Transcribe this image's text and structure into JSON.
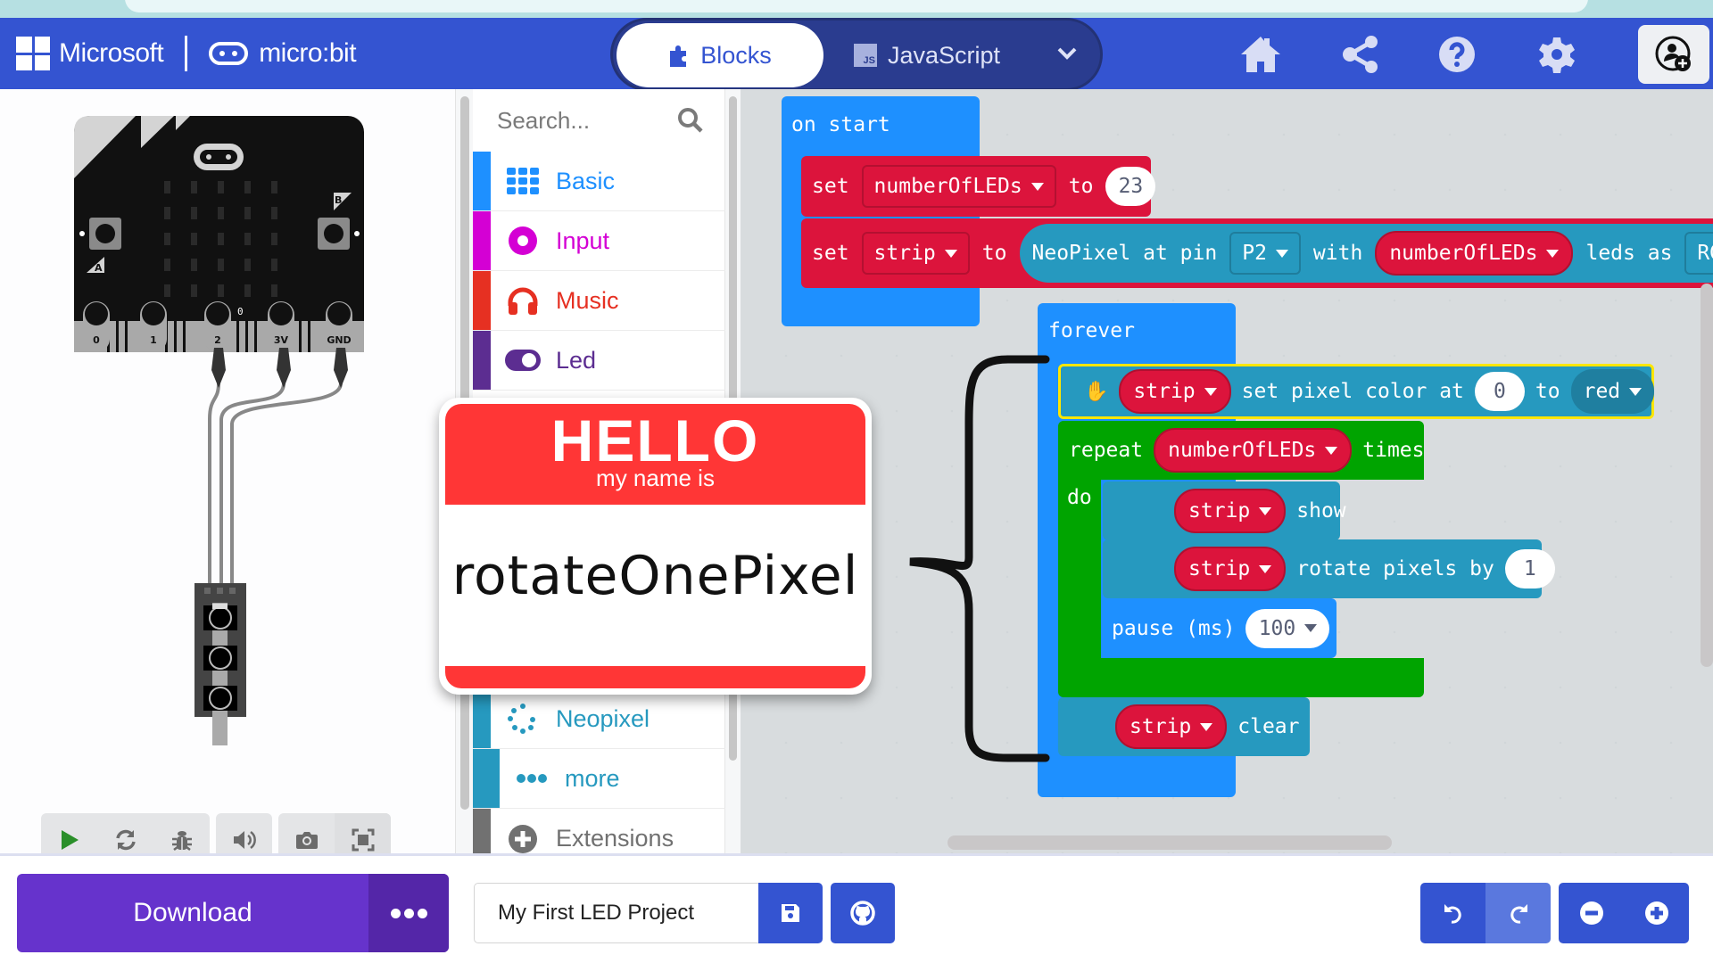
{
  "header": {
    "brand_microsoft": "Microsoft",
    "brand_microbit": "micro:bit",
    "tabs": [
      {
        "label": "Blocks",
        "icon": "puzzle-icon",
        "active": true
      },
      {
        "label": "JavaScript",
        "icon": "js-icon",
        "badge": "JS",
        "active": false
      }
    ],
    "icons": [
      "home-icon",
      "share-icon",
      "help-icon",
      "settings-icon",
      "profile-add-icon"
    ],
    "accent_color": "#3454d1"
  },
  "simulator": {
    "board": {
      "pin_labels": [
        "0",
        "1",
        "2",
        "3V",
        "GND"
      ],
      "button_labels": [
        "A",
        "B"
      ],
      "pin2_value": "0"
    },
    "controls": [
      {
        "name": "play",
        "icon": "play-icon"
      },
      {
        "name": "restart",
        "icon": "restart-icon"
      },
      {
        "name": "debug",
        "icon": "bug-icon"
      },
      {
        "name": "mute",
        "icon": "volume-icon"
      },
      {
        "name": "screenshot",
        "icon": "camera-icon"
      },
      {
        "name": "fullscreen",
        "icon": "fullscreen-icon"
      }
    ]
  },
  "toolbox": {
    "search_placeholder": "Search...",
    "categories": [
      {
        "label": "Basic",
        "color": "#1e90ff",
        "icon": "grid-icon"
      },
      {
        "label": "Input",
        "color": "#d400d4",
        "icon": "target-icon"
      },
      {
        "label": "Music",
        "color": "#e63022",
        "icon": "headphones-icon"
      },
      {
        "label": "Led",
        "color": "#5c2d91",
        "icon": "toggle-icon"
      },
      {
        "label": "Neopixel",
        "color": "#2699bf",
        "icon": "dots-circle-icon"
      },
      {
        "label": "more",
        "color": "#2699bf",
        "icon": "more-dots-icon"
      },
      {
        "label": "Extensions",
        "color": "#717171",
        "icon": "plus-circle-icon"
      }
    ]
  },
  "nametag": {
    "hello": "HELLO",
    "subtitle": "my name is",
    "name": "rotateOnePixel"
  },
  "workspace": {
    "on_start": {
      "label": "on start",
      "set1": {
        "kw": "set",
        "var": "numberOfLEDs",
        "to": "to",
        "value": "23"
      },
      "set2": {
        "kw": "set",
        "var": "strip",
        "to": "to",
        "neo": "NeoPixel at pin",
        "pin": "P2",
        "with": "with",
        "count_var": "numberOfLEDs",
        "leds_as": "leds as",
        "mode": "RGB ("
      }
    },
    "forever": {
      "label": "forever",
      "set_pixel": {
        "var": "strip",
        "text": "set pixel color at",
        "index": "0",
        "to": "to",
        "color": "red"
      },
      "repeat": {
        "kw": "repeat",
        "var": "numberOfLEDs",
        "times": "times",
        "do": "do"
      },
      "show": {
        "var": "strip",
        "text": "show"
      },
      "rotate": {
        "var": "strip",
        "text": "rotate pixels by",
        "value": "1"
      },
      "pause": {
        "text": "pause (ms)",
        "value": "100"
      },
      "clear": {
        "var": "strip",
        "text": "clear"
      }
    }
  },
  "bottom": {
    "download_label": "Download",
    "project_name": "My First LED Project",
    "icons": [
      "save-icon",
      "github-icon",
      "undo-icon",
      "redo-icon",
      "zoom-out-icon",
      "zoom-in-icon"
    ]
  }
}
